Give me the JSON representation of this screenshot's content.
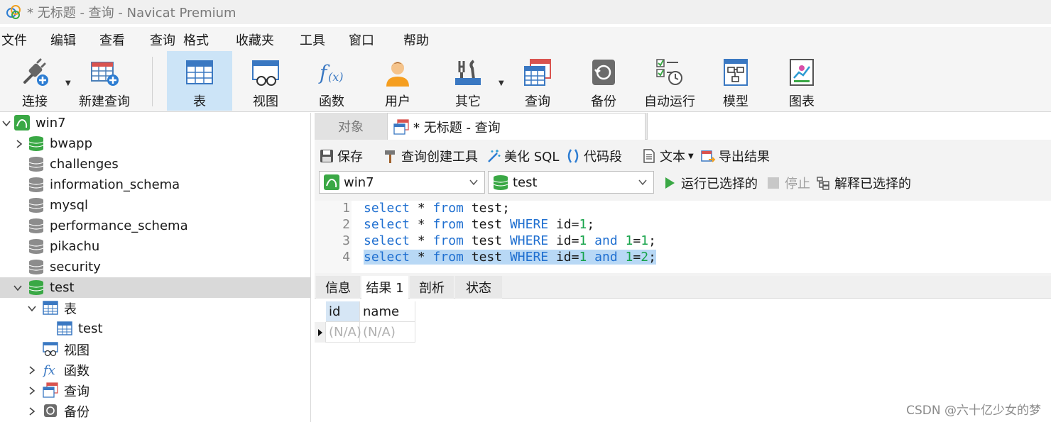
{
  "window": {
    "title": "* 无标题 - 查询 - Navicat Premium"
  },
  "menu": [
    "文件",
    "编辑",
    "查看",
    "查询",
    "格式",
    "收藏夹",
    "工具",
    "窗口",
    "帮助"
  ],
  "toolbar": {
    "connect": "连接",
    "new_query": "新建查询",
    "table": "表",
    "view": "视图",
    "function": "函数",
    "user": "用户",
    "other": "其它",
    "query": "查询",
    "backup": "备份",
    "automation": "自动运行",
    "model": "模型",
    "chart": "图表"
  },
  "tree": {
    "connection": "win7",
    "databases": [
      "bwapp",
      "challenges",
      "information_schema",
      "mysql",
      "performance_schema",
      "pikachu",
      "security",
      "test"
    ],
    "selected_db": "test",
    "children": {
      "tables": "表",
      "table_item": "test",
      "views": "视图",
      "functions": "函数",
      "queries": "查询",
      "backups": "备份"
    }
  },
  "tabs": {
    "objects": "对象",
    "query": "* 无标题 - 查询"
  },
  "query_toolbar": {
    "save": "保存",
    "builder": "查询创建工具",
    "beautify": "美化 SQL",
    "snippet": "代码段",
    "text": "文本",
    "export": "导出结果"
  },
  "selectors": {
    "connection": "win7",
    "database": "test",
    "run_selected": "运行已选择的",
    "stop": "停止",
    "explain_selected": "解释已选择的"
  },
  "editor": {
    "lines": [
      {
        "n": "1",
        "parts": [
          [
            "kw",
            "select"
          ],
          [
            "t",
            " * "
          ],
          [
            "kw",
            "from"
          ],
          [
            "t",
            " test;"
          ]
        ]
      },
      {
        "n": "2",
        "parts": [
          [
            "kw",
            "select"
          ],
          [
            "t",
            " * "
          ],
          [
            "kw",
            "from"
          ],
          [
            "t",
            " test "
          ],
          [
            "kw",
            "WHERE"
          ],
          [
            "t",
            " id="
          ],
          [
            "num",
            "1"
          ],
          [
            "t",
            ";"
          ]
        ]
      },
      {
        "n": "3",
        "parts": [
          [
            "kw",
            "select"
          ],
          [
            "t",
            " * "
          ],
          [
            "kw",
            "from"
          ],
          [
            "t",
            " test "
          ],
          [
            "kw",
            "WHERE"
          ],
          [
            "t",
            " id="
          ],
          [
            "num",
            "1"
          ],
          [
            "t",
            " "
          ],
          [
            "kw",
            "and"
          ],
          [
            "t",
            " "
          ],
          [
            "num",
            "1"
          ],
          [
            "t",
            "="
          ],
          [
            "num",
            "1"
          ],
          [
            "t",
            ";"
          ]
        ]
      },
      {
        "n": "4",
        "parts": [
          [
            "kw",
            "select"
          ],
          [
            "t",
            " * "
          ],
          [
            "kw",
            "from"
          ],
          [
            "t",
            " test "
          ],
          [
            "kw",
            "WHERE"
          ],
          [
            "t",
            " id="
          ],
          [
            "num",
            "1"
          ],
          [
            "t",
            " "
          ],
          [
            "kw",
            "and"
          ],
          [
            "t",
            " "
          ],
          [
            "num",
            "1"
          ],
          [
            "t",
            "="
          ],
          [
            "num",
            "2"
          ],
          [
            "t",
            ";"
          ]
        ]
      }
    ],
    "selected_line": "4"
  },
  "result_tabs": [
    "信息",
    "结果 1",
    "剖析",
    "状态"
  ],
  "result_active_tab": "结果 1",
  "result_grid": {
    "columns": [
      "id",
      "name"
    ],
    "rows": [
      [
        "(N/A)",
        "(N/A)"
      ]
    ]
  },
  "watermark": "CSDN @六十亿少女的梦",
  "colors": {
    "keyword": "#1f6fd0",
    "number": "#16a34a",
    "selection": "#b8d8f5",
    "active_toolbar": "#cce4f7"
  }
}
